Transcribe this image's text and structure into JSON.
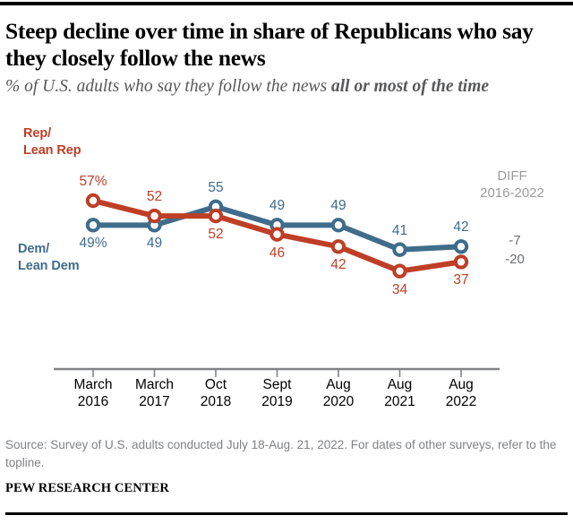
{
  "title": "Steep decline over time in share of Republicans who say they closely follow the news",
  "subtitle_plain": "% of U.S. adults who say they follow the news ",
  "subtitle_bold": "all or most of the time",
  "legend": {
    "rep_line1": "Rep/",
    "rep_line2": "Lean Rep",
    "dem_line1": "Dem/",
    "dem_line2": "Lean Dem"
  },
  "diff": {
    "header_line1": "DIFF",
    "header_line2": "2016-2022",
    "dem_value": "-7",
    "rep_value": "-20"
  },
  "source": "Source: Survey of U.S. adults conducted July 18-Aug. 21, 2022. For dates of other surveys, refer to the topline.",
  "brand": "PEW RESEARCH CENTER",
  "colors": {
    "rep": "#bf3e26",
    "dem": "#3f6c8b",
    "diff_text": "#6d6e71",
    "subtitle": "#58595b",
    "axis": "#808285"
  },
  "chart_data": {
    "type": "line",
    "title": "Steep decline over time in share of Republicans who say they closely follow the news",
    "subtitle": "% of U.S. adults who say they follow the news all or most of the time",
    "xlabel": "",
    "ylabel": "",
    "grid": false,
    "legend_position": "inline-left",
    "categories": [
      "March 2016",
      "March 2017",
      "Oct 2018",
      "Sept 2019",
      "Aug 2020",
      "Aug 2021",
      "Aug 2022"
    ],
    "category_lines": [
      [
        "March",
        "2016"
      ],
      [
        "March",
        "2017"
      ],
      [
        "Oct",
        "2018"
      ],
      [
        "Sept",
        "2019"
      ],
      [
        "Aug",
        "2020"
      ],
      [
        "Aug",
        "2021"
      ],
      [
        "Aug",
        "2022"
      ]
    ],
    "ylim": [
      30,
      60
    ],
    "series": [
      {
        "name": "Rep/Lean Rep",
        "color": "#bf3e26",
        "values": [
          57,
          52,
          52,
          46,
          42,
          34,
          37
        ],
        "labels": [
          "57%",
          "52",
          "52",
          "46",
          "42",
          "34",
          "37"
        ],
        "diff_2016_2022": -20
      },
      {
        "name": "Dem/Lean Dem",
        "color": "#3f6c8b",
        "values": [
          49,
          49,
          55,
          49,
          49,
          41,
          42
        ],
        "labels": [
          "49%",
          "49",
          "55",
          "49",
          "49",
          "41",
          "42"
        ],
        "diff_2016_2022": -7
      }
    ]
  }
}
